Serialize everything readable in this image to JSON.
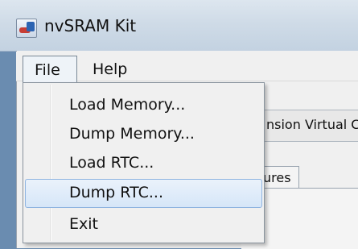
{
  "window": {
    "title": "nvSRAM Kit"
  },
  "menubar": {
    "items": [
      {
        "label": "File"
      },
      {
        "label": "Help"
      }
    ]
  },
  "file_menu": {
    "items": [
      {
        "label": "Load Memory..."
      },
      {
        "label": "Dump Memory..."
      },
      {
        "label": "Load RTC..."
      },
      {
        "label": "Dump RTC...",
        "highlighted": true
      },
      {
        "label": "Exit"
      }
    ]
  },
  "background": {
    "partial_label": "nsion Virtual C",
    "partial_tab": "ures"
  }
}
